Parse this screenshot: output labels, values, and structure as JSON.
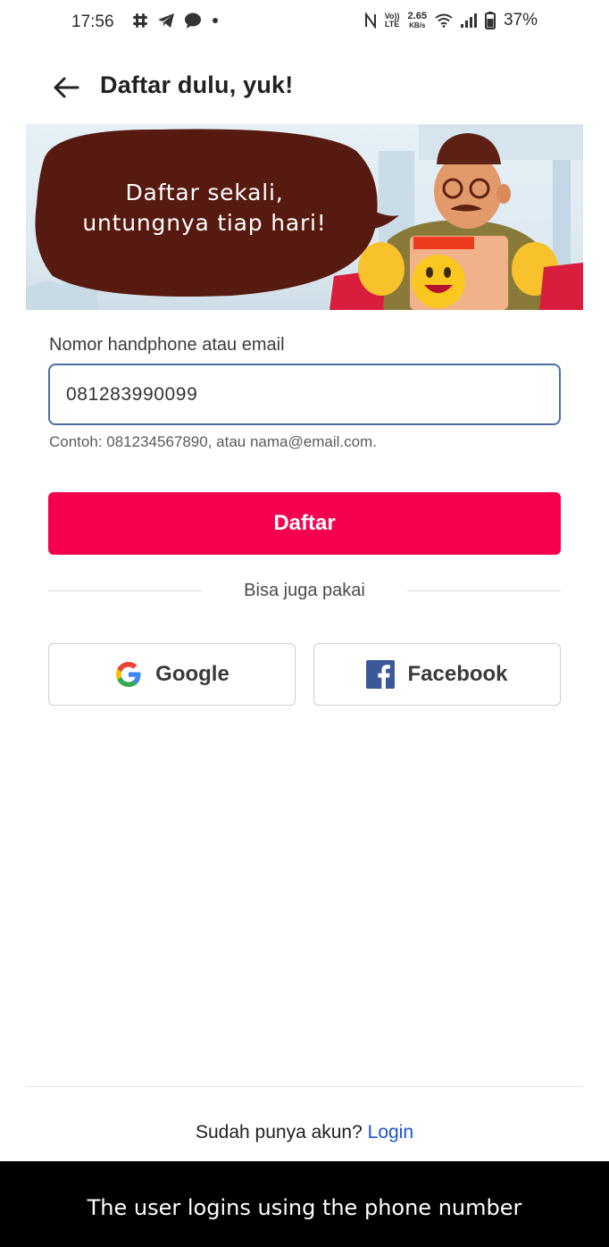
{
  "status_bar": {
    "time": "17:56",
    "network_top": "Vo))",
    "network_bottom": "LTE",
    "speed_value": "2.65",
    "speed_unit": "KB/s",
    "battery": "37%"
  },
  "header": {
    "title": "Daftar dulu, yuk!"
  },
  "banner": {
    "line1": "Daftar sekali,",
    "line2": "untungnya tiap hari!"
  },
  "form": {
    "label": "Nomor handphone atau email",
    "value": "081283990099",
    "hint": "Contoh: 081234567890, atau nama@email.com."
  },
  "primary_button": {
    "label": "Daftar"
  },
  "divider": {
    "text": "Bisa juga pakai"
  },
  "social": {
    "google_label": "Google",
    "facebook_label": "Facebook"
  },
  "footer": {
    "prompt": "Sudah punya akun?",
    "link": "Login"
  },
  "caption": {
    "text": "The user logins using the phone number"
  },
  "colors": {
    "primary": "#f5004e",
    "link": "#1a56c9",
    "input_border": "#4a6fa5",
    "facebook": "#3b5998"
  },
  "icons": [
    "back-arrow-icon",
    "slack-icon",
    "telegram-icon",
    "chat-bubble-icon",
    "nfc-icon",
    "wifi-icon",
    "signal-icon",
    "battery-icon",
    "google-icon",
    "facebook-icon"
  ]
}
